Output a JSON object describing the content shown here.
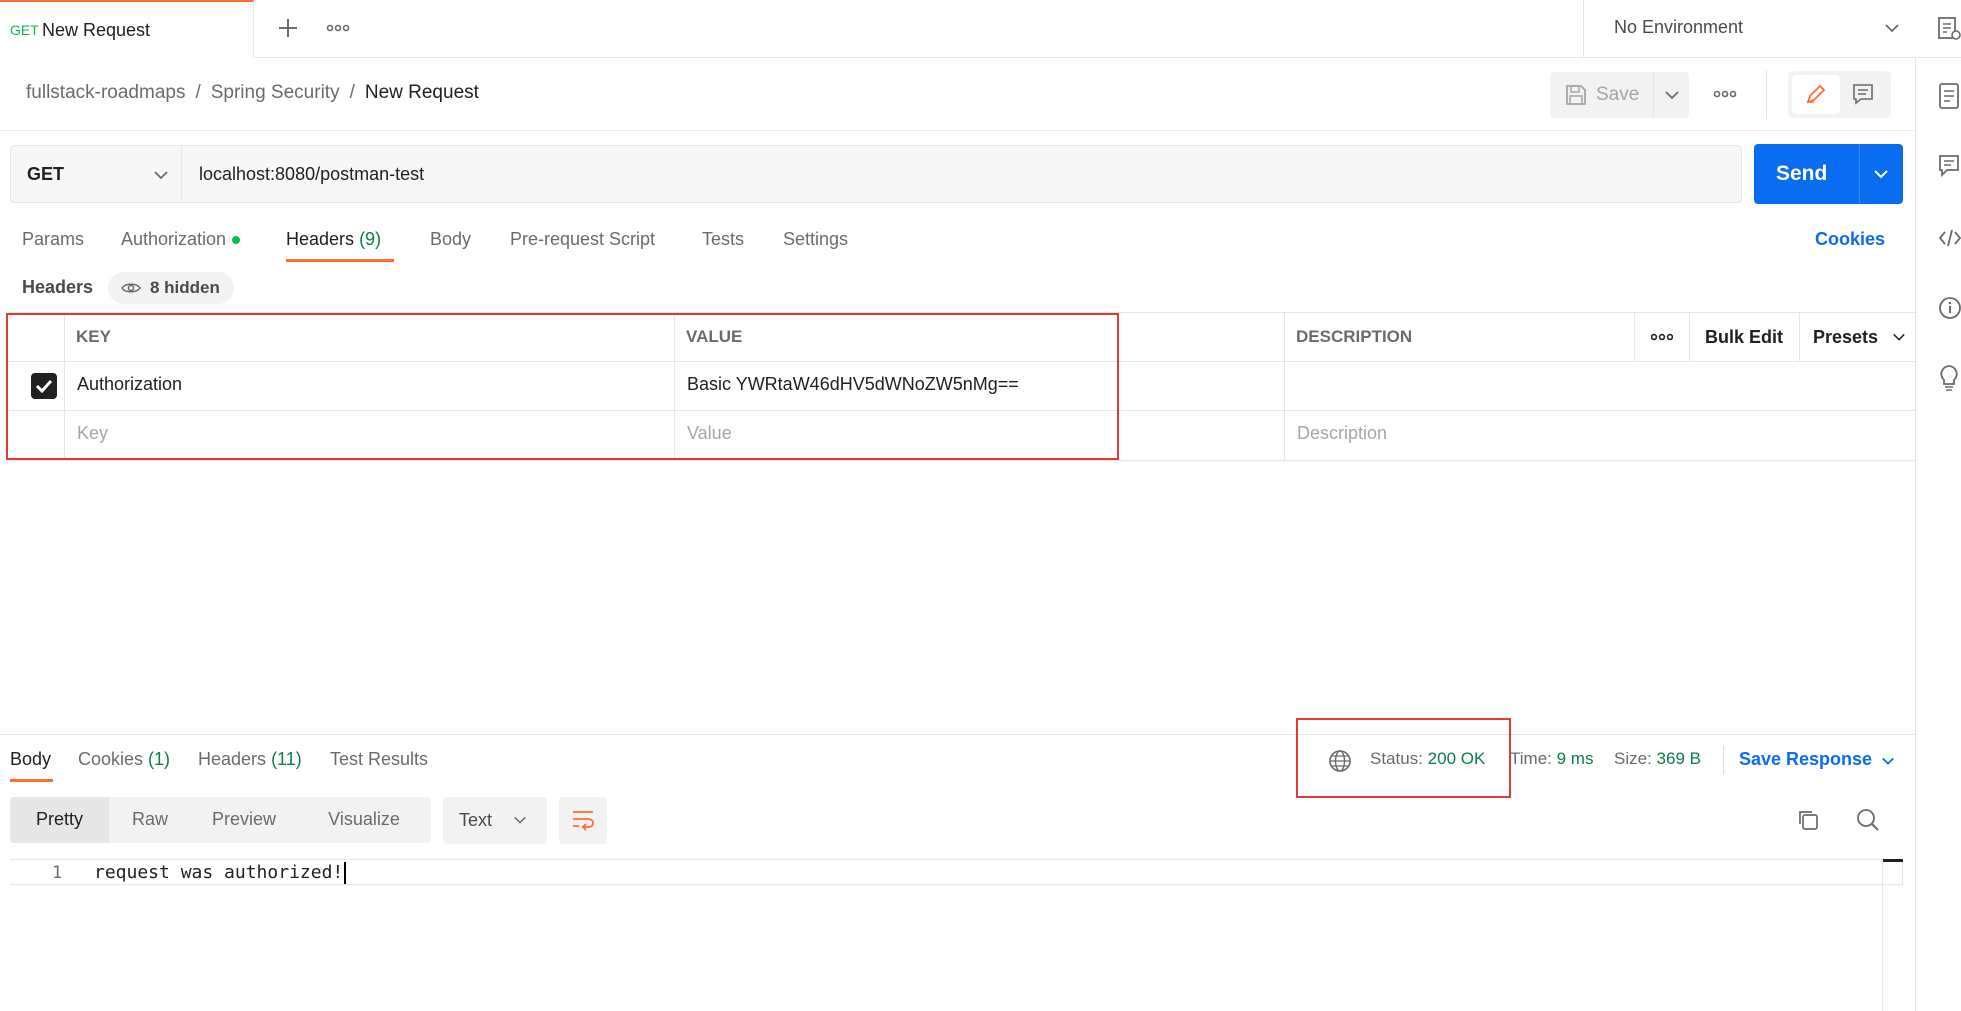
{
  "tabbar": {
    "tab_method": "GET",
    "tab_title": "New Request",
    "environment": "No Environment"
  },
  "breadcrumb": {
    "collection": "fullstack-roadmaps",
    "folder": "Spring Security",
    "request": "New Request",
    "separator": "/"
  },
  "toolbar": {
    "save_label": "Save"
  },
  "request": {
    "method": "GET",
    "url": "localhost:8080/postman-test",
    "send_label": "Send"
  },
  "request_tabs": {
    "params": "Params",
    "authorization": "Authorization",
    "headers": "Headers",
    "headers_count": "(9)",
    "body": "Body",
    "pre_request": "Pre-request Script",
    "tests": "Tests",
    "settings": "Settings",
    "cookies": "Cookies"
  },
  "headers_section": {
    "title": "Headers",
    "hidden": "8 hidden"
  },
  "table": {
    "columns": {
      "key": "KEY",
      "value": "VALUE",
      "description": "DESCRIPTION",
      "bulk_edit": "Bulk Edit",
      "presets": "Presets"
    },
    "rows": [
      {
        "key": "Authorization",
        "value": "Basic YWRtaW46dHV5dWNoZW5nMg==",
        "description": "",
        "checked": true
      }
    ],
    "placeholders": {
      "key": "Key",
      "value": "Value",
      "description": "Description"
    }
  },
  "response": {
    "tabs": {
      "body": "Body",
      "cookies": "Cookies",
      "cookies_count": "(1)",
      "headers": "Headers",
      "headers_count": "(11)",
      "test_results": "Test Results"
    },
    "status_label": "Status:",
    "status_value": "200 OK",
    "time_label": "Time:",
    "time_value": "9 ms",
    "size_label": "Size:",
    "size_value": "369 B",
    "save_response": "Save Response",
    "views": {
      "pretty": "Pretty",
      "raw": "Raw",
      "preview": "Preview",
      "visualize": "Visualize"
    },
    "format": "Text",
    "line_number": "1",
    "body_text": "request was authorized!"
  },
  "colors": {
    "accent": "#ff6c37",
    "send": "#0a6cf0",
    "success": "#0a8043",
    "highlight": "#e53935"
  }
}
